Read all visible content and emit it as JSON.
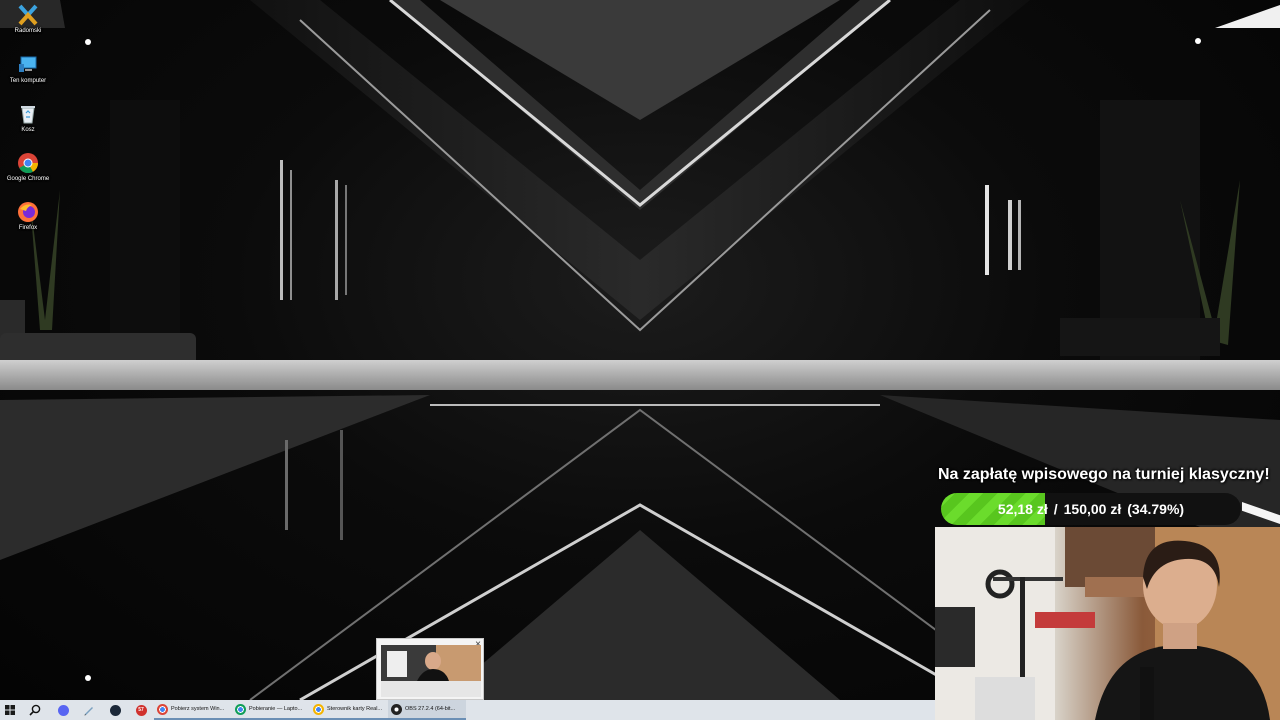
{
  "desktop_icons": [
    {
      "label": "Radomski",
      "icon": "app-icon"
    },
    {
      "label": "Ten komputer",
      "icon": "computer-icon"
    },
    {
      "label": "Kosz",
      "icon": "recycle-bin-icon"
    },
    {
      "label": "Google Chrome",
      "icon": "chrome-icon"
    },
    {
      "label": "Firefox",
      "icon": "firefox-icon"
    }
  ],
  "donation": {
    "title": "Na zapłatę wpisowego na turniej klasyczny!",
    "current": "52,18 zł",
    "separator": "/",
    "goal": "150,00 zł",
    "percent_text": "(34.79%)",
    "progress_fraction": 0.3479,
    "accent": "#6bdc2c"
  },
  "taskbar": {
    "pinned": [
      {
        "icon": "windows-start-icon"
      },
      {
        "icon": "search-icon"
      },
      {
        "icon": "discord-icon"
      },
      {
        "icon": "pen-icon"
      },
      {
        "icon": "steam-icon"
      },
      {
        "icon": "app-57-icon",
        "text": "57"
      }
    ],
    "apps": [
      {
        "icon": "chrome-icon",
        "title": "Pobierz system Win..."
      },
      {
        "icon": "chrome-icon",
        "title": "Pobieranie — Lapto..."
      },
      {
        "icon": "chrome-icon",
        "title": "Sterownik karty Real..."
      },
      {
        "icon": "obs-icon",
        "title": "OBS 27.2.4 (64-bit..."
      }
    ],
    "background": "#dfe4ea"
  },
  "thumbnail": {
    "close_label": "×"
  }
}
